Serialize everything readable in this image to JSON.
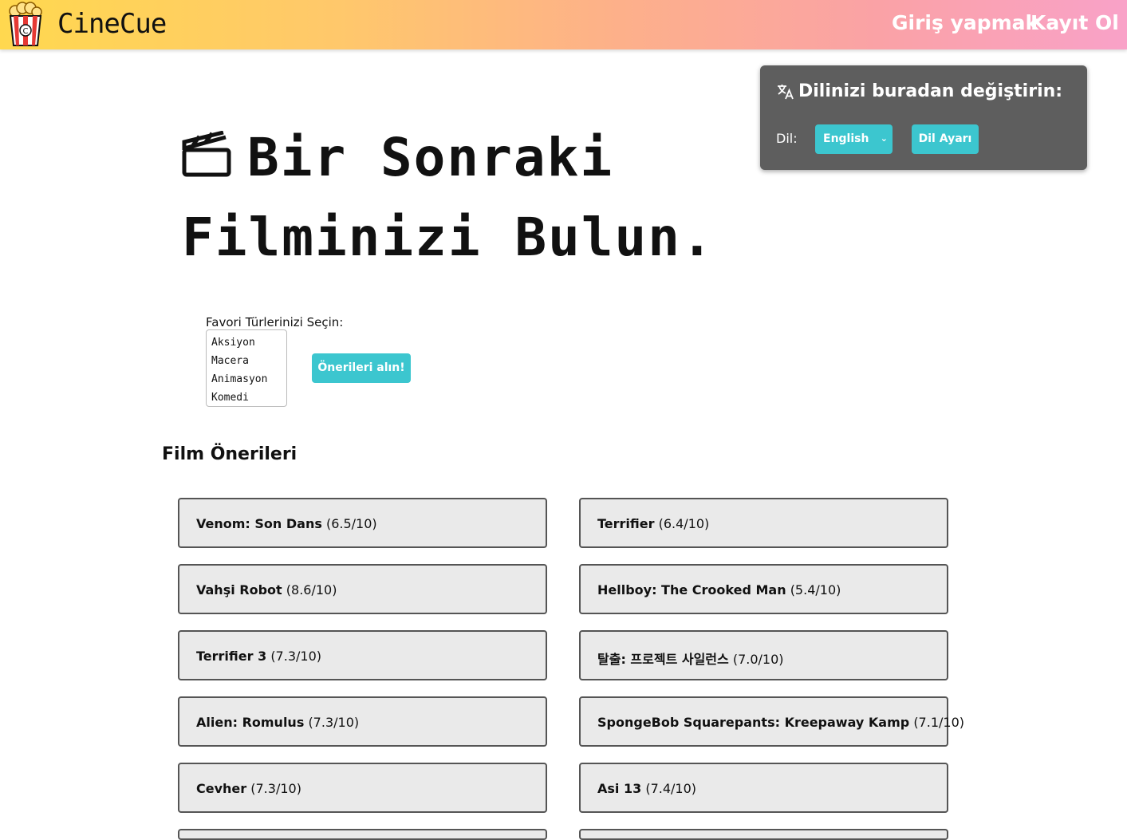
{
  "header": {
    "brand": "CineCue",
    "login": "Giriş yapmak",
    "register": "Kayıt Ol"
  },
  "language_panel": {
    "title": "Dilinizi buradan değiştirin:",
    "label": "Dil:",
    "selected": "English",
    "button": "Dil Ayarı",
    "accent": "#3cc6cf"
  },
  "hero": {
    "line1": "Bir Sonraki",
    "line2": "Filminizi Bulun."
  },
  "genres": {
    "label": "Favori Türlerinizi Seçin:",
    "options": [
      "Aksiyon",
      "Macera",
      "Animasyon",
      "Komedi"
    ],
    "button": "Önerileri alın!"
  },
  "recommendations": {
    "title": "Film Önerileri",
    "movies": [
      {
        "title": "Venom: Son Dans",
        "rating": "(6.5/10)"
      },
      {
        "title": "Terrifier",
        "rating": "(6.4/10)"
      },
      {
        "title": "Vahşi Robot",
        "rating": "(8.6/10)"
      },
      {
        "title": "Hellboy: The Crooked Man",
        "rating": "(5.4/10)"
      },
      {
        "title": "Terrifier 3",
        "rating": "(7.3/10)"
      },
      {
        "title": "탈출: 프로젝트 사일런스",
        "rating": "(7.0/10)"
      },
      {
        "title": "Alien: Romulus",
        "rating": "(7.3/10)"
      },
      {
        "title": "SpongeBob Squarepants: Kreepaway Kamp",
        "rating": "(7.1/10)"
      },
      {
        "title": "Cevher",
        "rating": "(7.3/10)"
      },
      {
        "title": "Asi 13",
        "rating": "(7.4/10)"
      }
    ]
  }
}
